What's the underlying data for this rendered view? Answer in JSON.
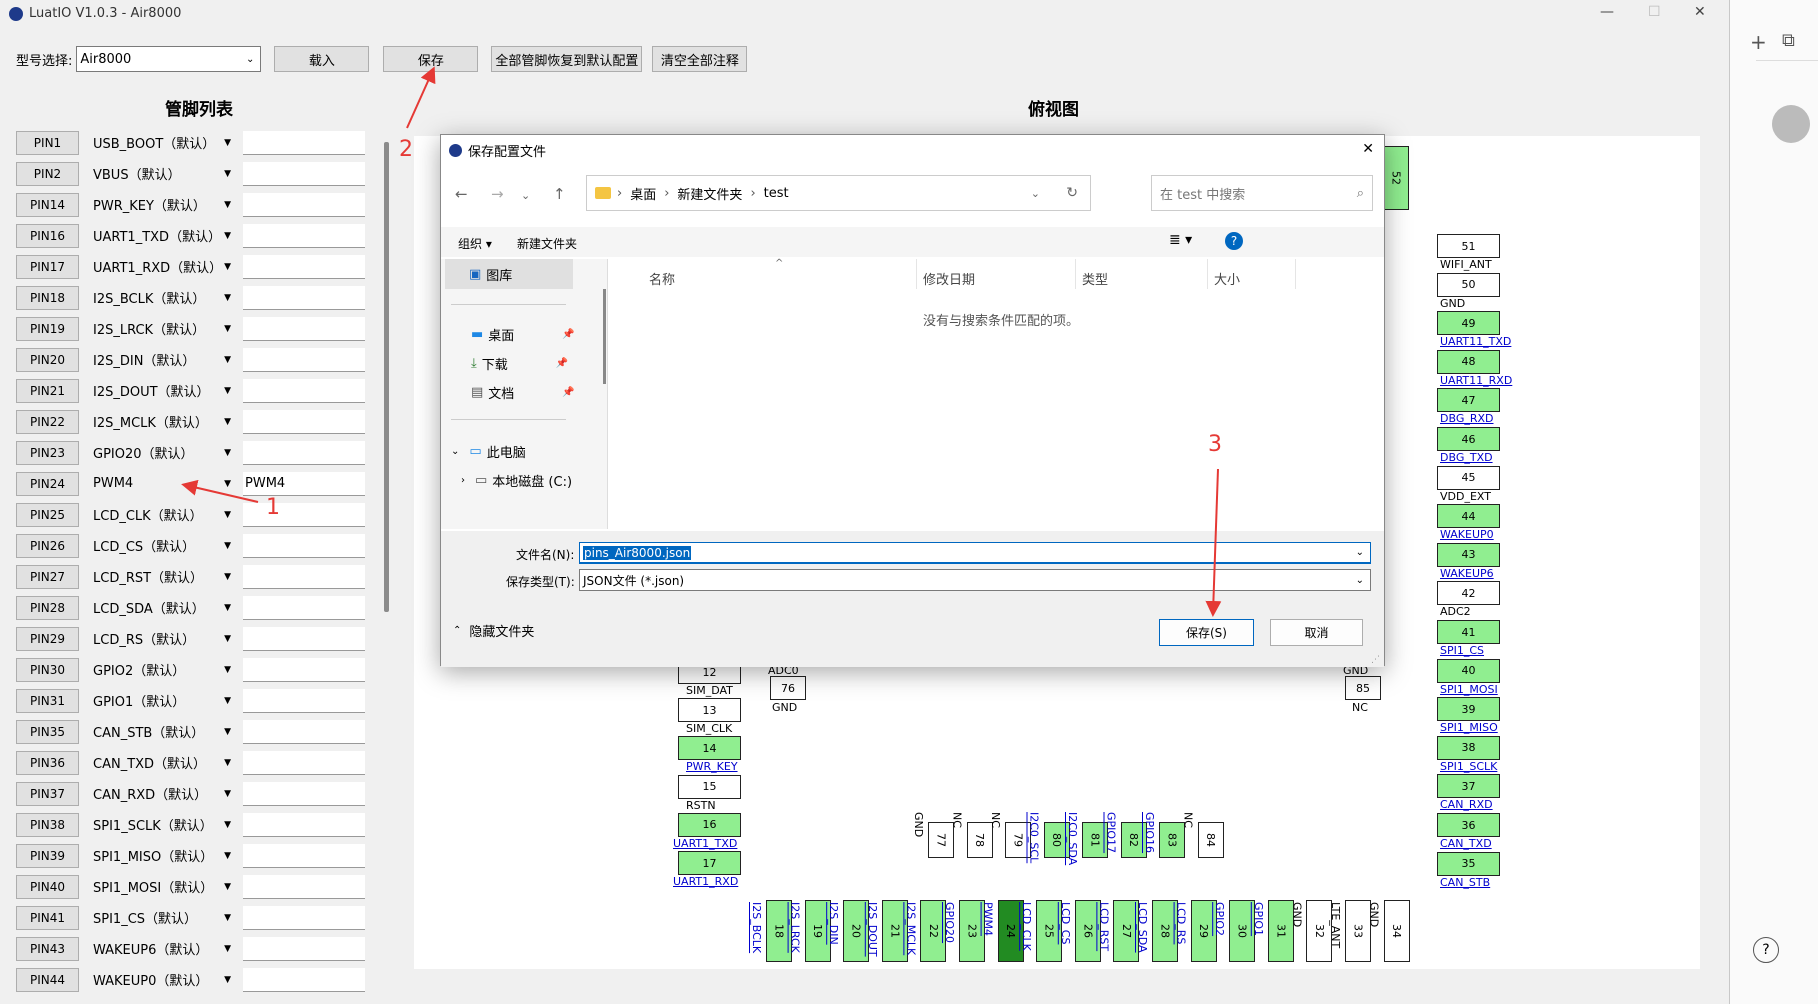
{
  "window": {
    "title": "LuatIO V1.0.3 - Air8000",
    "minimize": "—",
    "maximize": "☐",
    "close": "✕"
  },
  "toolbar": {
    "model_label": "型号选择:",
    "model_value": "Air8000",
    "load": "载入",
    "save": "保存",
    "reset_all": "全部管脚恢复到默认配置",
    "clear_notes": "清空全部注释"
  },
  "sections": {
    "pin_list": "管脚列表",
    "top_view": "俯视图"
  },
  "pins": [
    {
      "pin": "PIN1",
      "func": "USB_BOOT（默认）",
      "value": ""
    },
    {
      "pin": "PIN2",
      "func": "VBUS（默认）",
      "value": ""
    },
    {
      "pin": "PIN14",
      "func": "PWR_KEY（默认）",
      "value": ""
    },
    {
      "pin": "PIN16",
      "func": "UART1_TXD（默认）",
      "value": ""
    },
    {
      "pin": "PIN17",
      "func": "UART1_RXD（默认）",
      "value": ""
    },
    {
      "pin": "PIN18",
      "func": "I2S_BCLK（默认）",
      "value": ""
    },
    {
      "pin": "PIN19",
      "func": "I2S_LRCK（默认）",
      "value": ""
    },
    {
      "pin": "PIN20",
      "func": "I2S_DIN（默认）",
      "value": ""
    },
    {
      "pin": "PIN21",
      "func": "I2S_DOUT（默认）",
      "value": ""
    },
    {
      "pin": "PIN22",
      "func": "I2S_MCLK（默认）",
      "value": ""
    },
    {
      "pin": "PIN23",
      "func": "GPIO20（默认）",
      "value": ""
    },
    {
      "pin": "PIN24",
      "func": "PWM4",
      "value": "PWM4"
    },
    {
      "pin": "PIN25",
      "func": "LCD_CLK（默认）",
      "value": ""
    },
    {
      "pin": "PIN26",
      "func": "LCD_CS（默认）",
      "value": ""
    },
    {
      "pin": "PIN27",
      "func": "LCD_RST（默认）",
      "value": ""
    },
    {
      "pin": "PIN28",
      "func": "LCD_SDA（默认）",
      "value": ""
    },
    {
      "pin": "PIN29",
      "func": "LCD_RS（默认）",
      "value": ""
    },
    {
      "pin": "PIN30",
      "func": "GPIO2（默认）",
      "value": ""
    },
    {
      "pin": "PIN31",
      "func": "GPIO1（默认）",
      "value": ""
    },
    {
      "pin": "PIN35",
      "func": "CAN_STB（默认）",
      "value": ""
    },
    {
      "pin": "PIN36",
      "func": "CAN_TXD（默认）",
      "value": ""
    },
    {
      "pin": "PIN37",
      "func": "CAN_RXD（默认）",
      "value": ""
    },
    {
      "pin": "PIN38",
      "func": "SPI1_SCLK（默认）",
      "value": ""
    },
    {
      "pin": "PIN39",
      "func": "SPI1_MISO（默认）",
      "value": ""
    },
    {
      "pin": "PIN40",
      "func": "SPI1_MOSI（默认）",
      "value": ""
    },
    {
      "pin": "PIN41",
      "func": "SPI1_CS（默认）",
      "value": ""
    },
    {
      "pin": "PIN43",
      "func": "WAKEUP6（默认）",
      "value": ""
    },
    {
      "pin": "PIN44",
      "func": "WAKEUP0（默认）",
      "value": ""
    }
  ],
  "diagram": {
    "right_pins": [
      {
        "n": "52",
        "label": "",
        "color": "green"
      },
      {
        "n": "51",
        "label": "WIFI_ANT",
        "color": "white"
      },
      {
        "n": "50",
        "label": "GND",
        "color": "white"
      },
      {
        "n": "49",
        "label": "UART11_TXD",
        "color": "green"
      },
      {
        "n": "48",
        "label": "UART11_RXD",
        "color": "green"
      },
      {
        "n": "47",
        "label": "DBG_RXD",
        "color": "green"
      },
      {
        "n": "46",
        "label": "DBG_TXD",
        "color": "green"
      },
      {
        "n": "45",
        "label": "VDD_EXT",
        "color": "white"
      },
      {
        "n": "44",
        "label": "WAKEUP0",
        "color": "green"
      },
      {
        "n": "43",
        "label": "WAKEUP6",
        "color": "green"
      },
      {
        "n": "42",
        "label": "ADC2",
        "color": "white"
      },
      {
        "n": "41",
        "label": "SPI1_CS",
        "color": "green"
      },
      {
        "n": "40",
        "label": "SPI1_MOSI",
        "color": "green"
      },
      {
        "n": "39",
        "label": "SPI1_MISO",
        "color": "green"
      },
      {
        "n": "38",
        "label": "SPI1_SCLK",
        "color": "green"
      },
      {
        "n": "37",
        "label": "CAN_RXD",
        "color": "green"
      },
      {
        "n": "36",
        "label": "CAN_TXD",
        "color": "green"
      },
      {
        "n": "35",
        "label": "CAN_STB",
        "color": "green"
      }
    ],
    "left_pins": [
      {
        "n": "12",
        "label": "SIM_DAT",
        "color": "white"
      },
      {
        "n": "13",
        "label": "SIM_CLK",
        "color": "white"
      },
      {
        "n": "14",
        "label": "PWR_KEY",
        "color": "green"
      },
      {
        "n": "15",
        "label": "RSTN",
        "color": "white"
      },
      {
        "n": "16",
        "label": "UART1_TXD",
        "color": "green"
      },
      {
        "n": "17",
        "label": "UART1_RXD",
        "color": "green"
      }
    ],
    "pin76": {
      "n": "76",
      "top": "ADC0",
      "bottom": "GND"
    },
    "pin85": {
      "n": "85",
      "top": "GND",
      "bottom": "NC"
    },
    "inner_pins": [
      {
        "n": "77",
        "label": "GND",
        "color": "white"
      },
      {
        "n": "78",
        "label": "NC",
        "color": "white"
      },
      {
        "n": "79",
        "label": "NC",
        "color": "white"
      },
      {
        "n": "80",
        "label": "I2C0_SCL",
        "color": "green"
      },
      {
        "n": "81",
        "label": "I2C0_SDA",
        "color": "green"
      },
      {
        "n": "82",
        "label": "GPIO17",
        "color": "green"
      },
      {
        "n": "83",
        "label": "GPIO16",
        "color": "green"
      },
      {
        "n": "84",
        "label": "NC",
        "color": "white"
      }
    ],
    "bottom_pins": [
      {
        "n": "18",
        "label": "I2S_BCLK",
        "color": "green"
      },
      {
        "n": "19",
        "label": "I2S_LRCK",
        "color": "green"
      },
      {
        "n": "20",
        "label": "I2S_DIN",
        "color": "green"
      },
      {
        "n": "21",
        "label": "I2S_DOUT",
        "color": "green"
      },
      {
        "n": "22",
        "label": "I2S_MCLK",
        "color": "green"
      },
      {
        "n": "23",
        "label": "GPIO20",
        "color": "green"
      },
      {
        "n": "24",
        "label": "PWM4",
        "color": "darkgreen"
      },
      {
        "n": "25",
        "label": "LCD_CLK",
        "color": "green"
      },
      {
        "n": "26",
        "label": "LCD_CS",
        "color": "green"
      },
      {
        "n": "27",
        "label": "LCD_RST",
        "color": "green"
      },
      {
        "n": "28",
        "label": "LCD_SDA",
        "color": "green"
      },
      {
        "n": "29",
        "label": "LCD_RS",
        "color": "green"
      },
      {
        "n": "30",
        "label": "GPIO2",
        "color": "green"
      },
      {
        "n": "31",
        "label": "GPIO1",
        "color": "green"
      },
      {
        "n": "32",
        "label": "GND",
        "color": "white"
      },
      {
        "n": "33",
        "label": "LTE_ANT",
        "color": "white"
      },
      {
        "n": "34",
        "label": "GND",
        "color": "white"
      }
    ]
  },
  "dialog": {
    "title": "保存配置文件",
    "close": "✕",
    "path": [
      "桌面",
      "新建文件夹",
      "test"
    ],
    "search_placeholder": "在 test 中搜索",
    "organize": "组织 ▾",
    "new_folder": "新建文件夹",
    "help": "?",
    "nav": {
      "gallery": "图库",
      "desktop": "桌面",
      "downloads": "下载",
      "documents": "文档",
      "this_pc": "此电脑",
      "local_disk": "本地磁盘 (C:)"
    },
    "columns": [
      "名称",
      "修改日期",
      "类型",
      "大小"
    ],
    "empty_message": "没有与搜索条件匹配的项。",
    "filename_label": "文件名(N):",
    "filename_value": "pins_Air8000.json",
    "filetype_label": "保存类型(T):",
    "filetype_value": "JSON文件 (*.json)",
    "hide_folders": "隐藏文件夹",
    "save": "保存(S)",
    "cancel": "取消"
  },
  "annotations": [
    "1",
    "2",
    "3"
  ],
  "colors": {
    "green": "#90ee90",
    "dark_green": "#228b22",
    "annotation_red": "#e53935",
    "link_blue": "#0000cd",
    "accent_blue": "#0067c0"
  }
}
